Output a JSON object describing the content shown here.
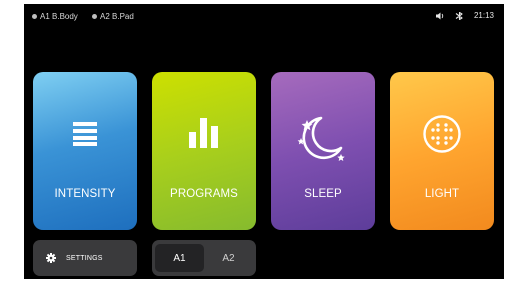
{
  "statusbar": {
    "devices": [
      {
        "label": "A1 B.Body"
      },
      {
        "label": "A2 B.Pad"
      }
    ],
    "time": "21:13",
    "volume_icon": "speaker-icon",
    "bluetooth_icon": "bluetooth-icon"
  },
  "tiles": [
    {
      "label": "INTENSITY",
      "icon": "intensity-bars-icon",
      "color": "#3a93d6"
    },
    {
      "label": "PROGRAMS",
      "icon": "bar-chart-icon",
      "color": "#a8cf1c"
    },
    {
      "label": "SLEEP",
      "icon": "moon-stars-icon",
      "color": "#7e4fb0"
    },
    {
      "label": "LIGHT",
      "icon": "light-dots-icon",
      "color": "#ffa52f"
    }
  ],
  "settings": {
    "label": "SETTINGS",
    "icon": "gear-icon"
  },
  "segment": {
    "options": [
      {
        "label": "A1",
        "selected": true
      },
      {
        "label": "A2",
        "selected": false
      }
    ]
  }
}
